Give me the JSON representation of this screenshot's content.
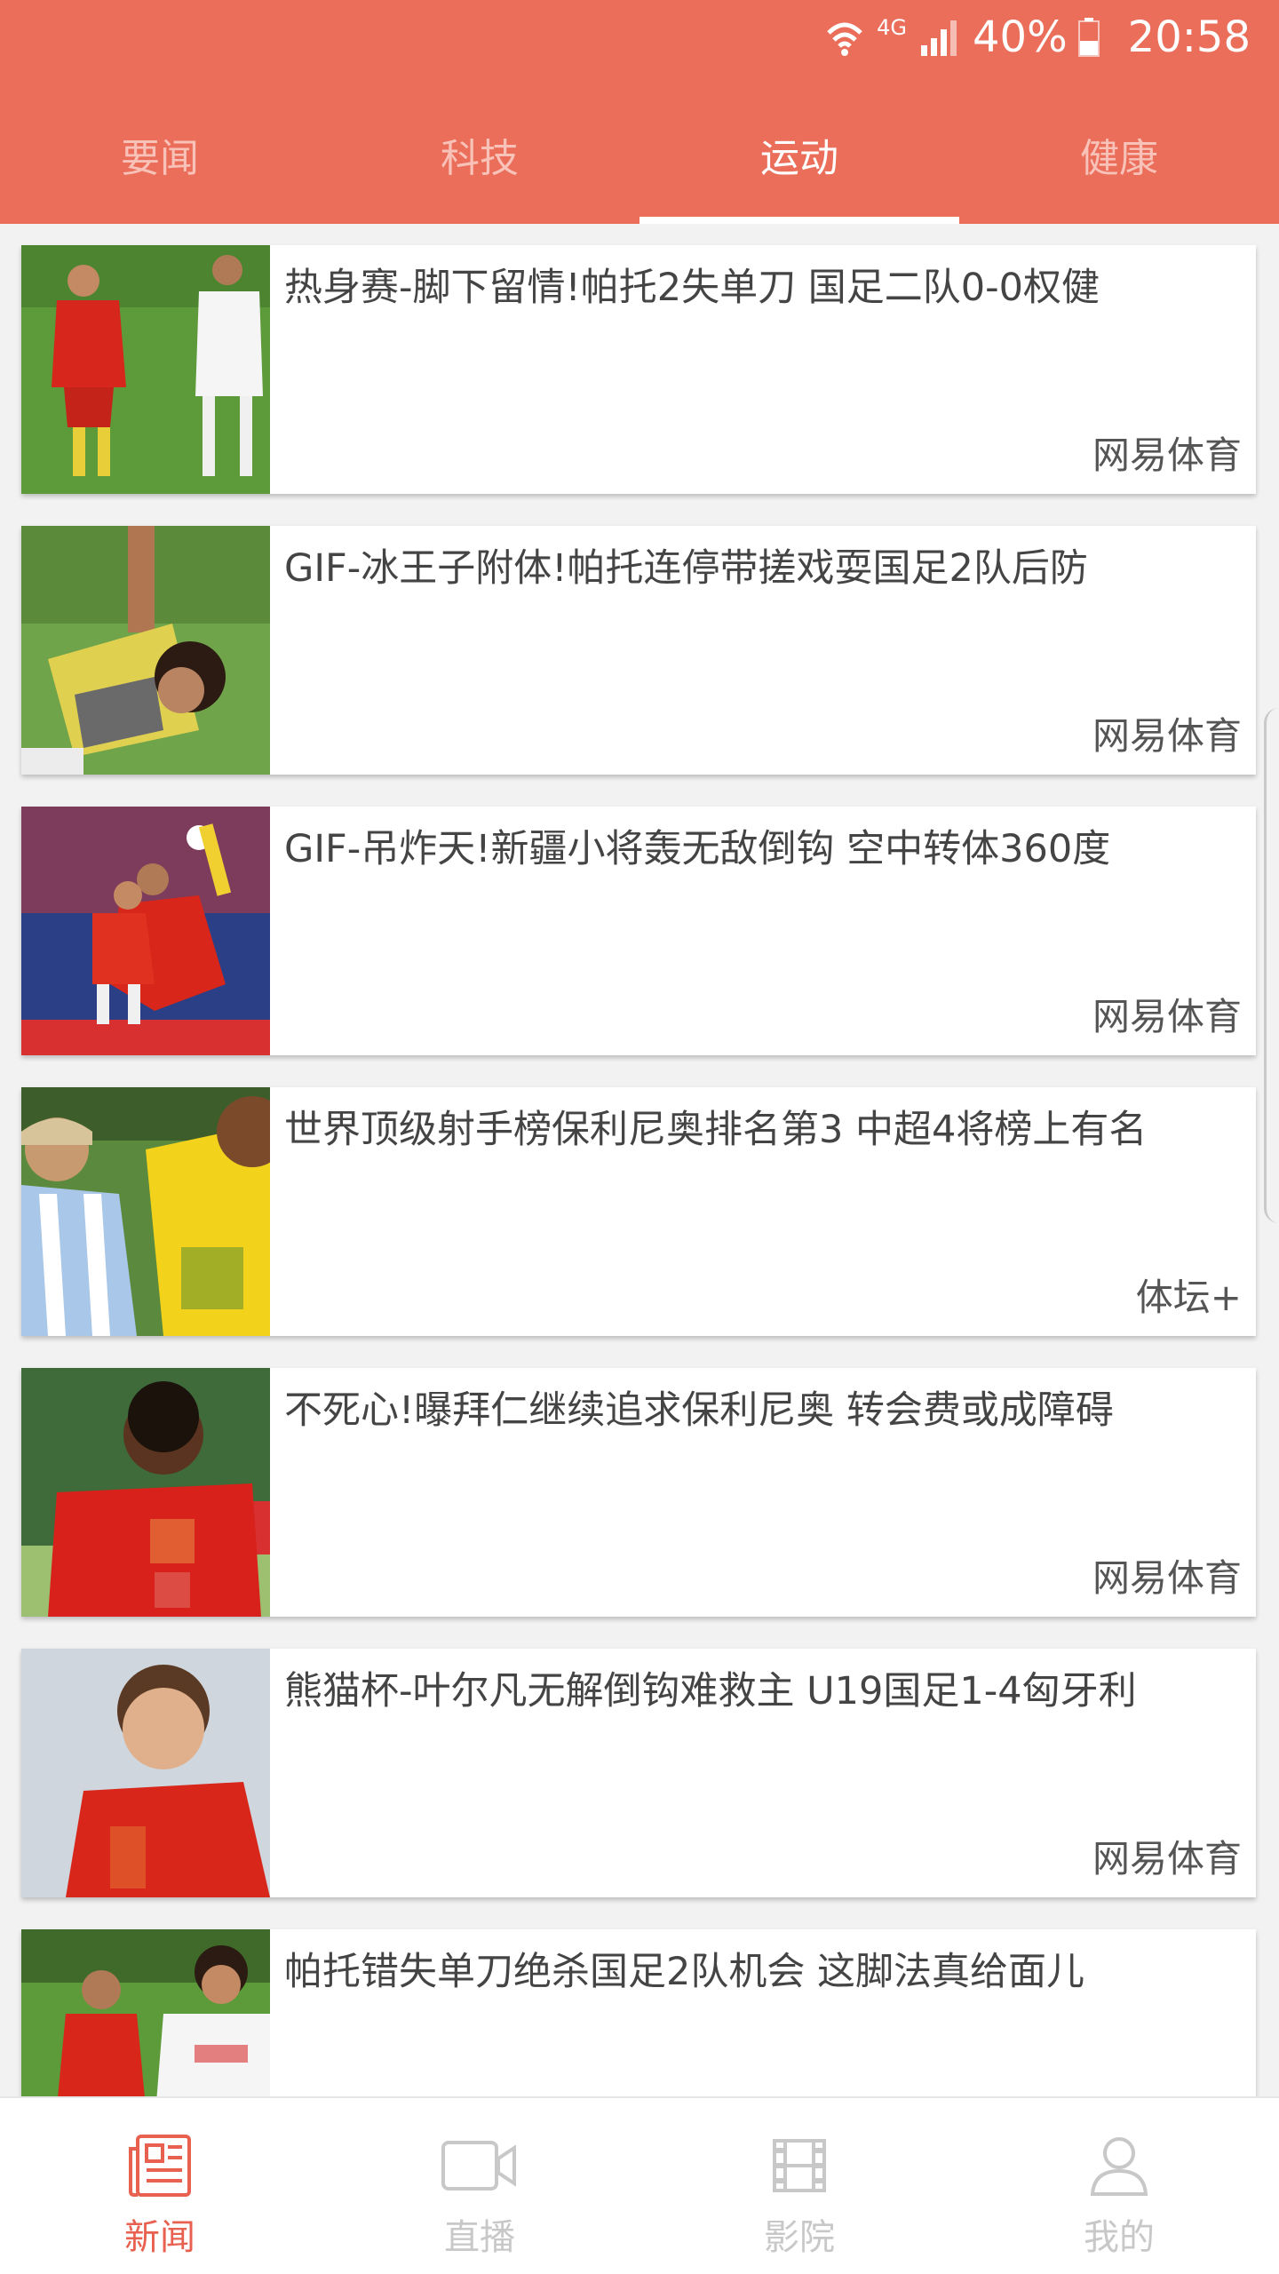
{
  "status_bar": {
    "network": "4G",
    "battery": "40%",
    "time": "20:58"
  },
  "tabs": [
    {
      "label": "要闻",
      "active": false
    },
    {
      "label": "科技",
      "active": false
    },
    {
      "label": "运动",
      "active": true
    },
    {
      "label": "健康",
      "active": false
    }
  ],
  "news": [
    {
      "title": "热身赛-脚下留情!帕托2失单刀 国足二队0-0权健",
      "source": "网易体育"
    },
    {
      "title": "GIF-冰王子附体!帕托连停带搓戏耍国足2队后防",
      "source": "网易体育"
    },
    {
      "title": "GIF-吊炸天!新疆小将轰无敌倒钩 空中转体360度",
      "source": "网易体育"
    },
    {
      "title": "世界顶级射手榜保利尼奥排名第3 中超4将榜上有名",
      "source": "体坛+"
    },
    {
      "title": "不死心!曝拜仁继续追求保利尼奥 转会费或成障碍",
      "source": "网易体育"
    },
    {
      "title": "熊猫杯-叶尔凡无解倒钩难救主 U19国足1-4匈牙利",
      "source": "网易体育"
    },
    {
      "title": "帕托错失单刀绝杀国足2队机会 这脚法真给面儿",
      "source": ""
    }
  ],
  "bottom_nav": [
    {
      "label": "新闻",
      "icon": "newspaper-icon",
      "active": true
    },
    {
      "label": "直播",
      "icon": "video-camera-icon",
      "active": false
    },
    {
      "label": "影院",
      "icon": "film-icon",
      "active": false
    },
    {
      "label": "我的",
      "icon": "user-icon",
      "active": false
    }
  ],
  "colors": {
    "header_bg": "#ea6e5a",
    "active_nav": "#e8604f",
    "inactive_nav": "#c8c8c8"
  }
}
